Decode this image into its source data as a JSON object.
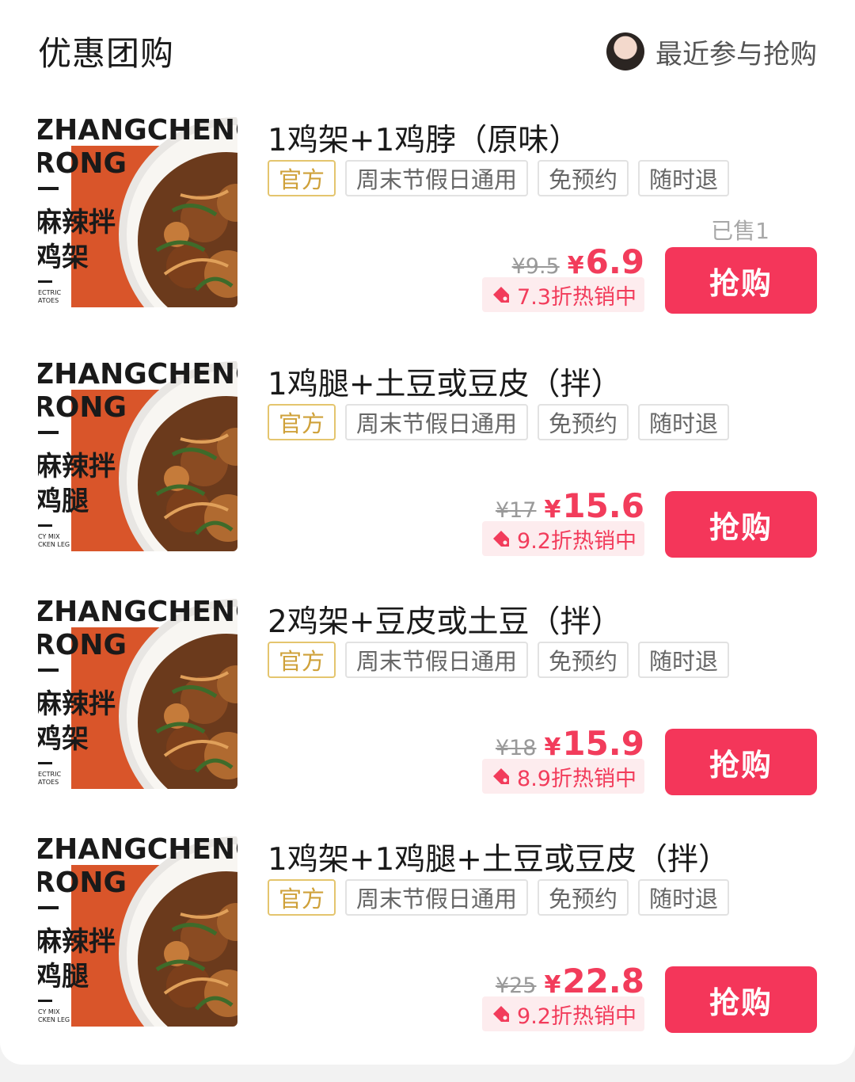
{
  "header": {
    "title": "优惠团购",
    "recent_label": "最近参与抢购"
  },
  "items": [
    {
      "name": "1鸡架+1鸡脖（原味）",
      "tags": [
        "官方",
        "周末节假日通用",
        "免预约",
        "随时退"
      ],
      "sold": "已售1",
      "original_price": "¥9.5",
      "currency": "¥",
      "price": "6.9",
      "hot_label": "7.3折热销中",
      "buy_label": "抢购",
      "image": {
        "brand_line1": "ZHANGCHENG",
        "brand_line2": "RONG",
        "dish_line1": "麻辣拌",
        "dish_line2": "鸡架",
        "tiny_line1": "ECTRIC",
        "tiny_line2": "ATOES"
      }
    },
    {
      "name": "1鸡腿+土豆或豆皮（拌）",
      "tags": [
        "官方",
        "周末节假日通用",
        "免预约",
        "随时退"
      ],
      "sold": "",
      "original_price": "¥17",
      "currency": "¥",
      "price": "15.6",
      "hot_label": "9.2折热销中",
      "buy_label": "抢购",
      "image": {
        "brand_line1": "ZHANGCHENG",
        "brand_line2": "RONG",
        "dish_line1": "麻辣拌",
        "dish_line2": "鸡腿",
        "tiny_line1": "CY MIX",
        "tiny_line2": "CKEN LEG"
      }
    },
    {
      "name": "2鸡架+豆皮或土豆（拌）",
      "tags": [
        "官方",
        "周末节假日通用",
        "免预约",
        "随时退"
      ],
      "sold": "",
      "original_price": "¥18",
      "currency": "¥",
      "price": "15.9",
      "hot_label": "8.9折热销中",
      "buy_label": "抢购",
      "image": {
        "brand_line1": "ZHANGCHENG",
        "brand_line2": "RONG",
        "dish_line1": "麻辣拌",
        "dish_line2": "鸡架",
        "tiny_line1": "ECTRIC",
        "tiny_line2": "ATOES"
      }
    },
    {
      "name": "1鸡架+1鸡腿+土豆或豆皮（拌）",
      "tags": [
        "官方",
        "周末节假日通用",
        "免预约",
        "随时退"
      ],
      "sold": "",
      "original_price": "¥25",
      "currency": "¥",
      "price": "22.8",
      "hot_label": "9.2折热销中",
      "buy_label": "抢购",
      "image": {
        "brand_line1": "ZHANGCHENG",
        "brand_line2": "RONG",
        "dish_line1": "麻辣拌",
        "dish_line2": "鸡腿",
        "tiny_line1": "CY MIX",
        "tiny_line2": "CKEN LEG"
      }
    }
  ],
  "colors": {
    "accent": "#f4365a",
    "price": "#f23c5b",
    "official_tag": "#cfa13a",
    "image_orange": "#d9552a"
  },
  "icons": {
    "hot": "price-tag-icon"
  }
}
